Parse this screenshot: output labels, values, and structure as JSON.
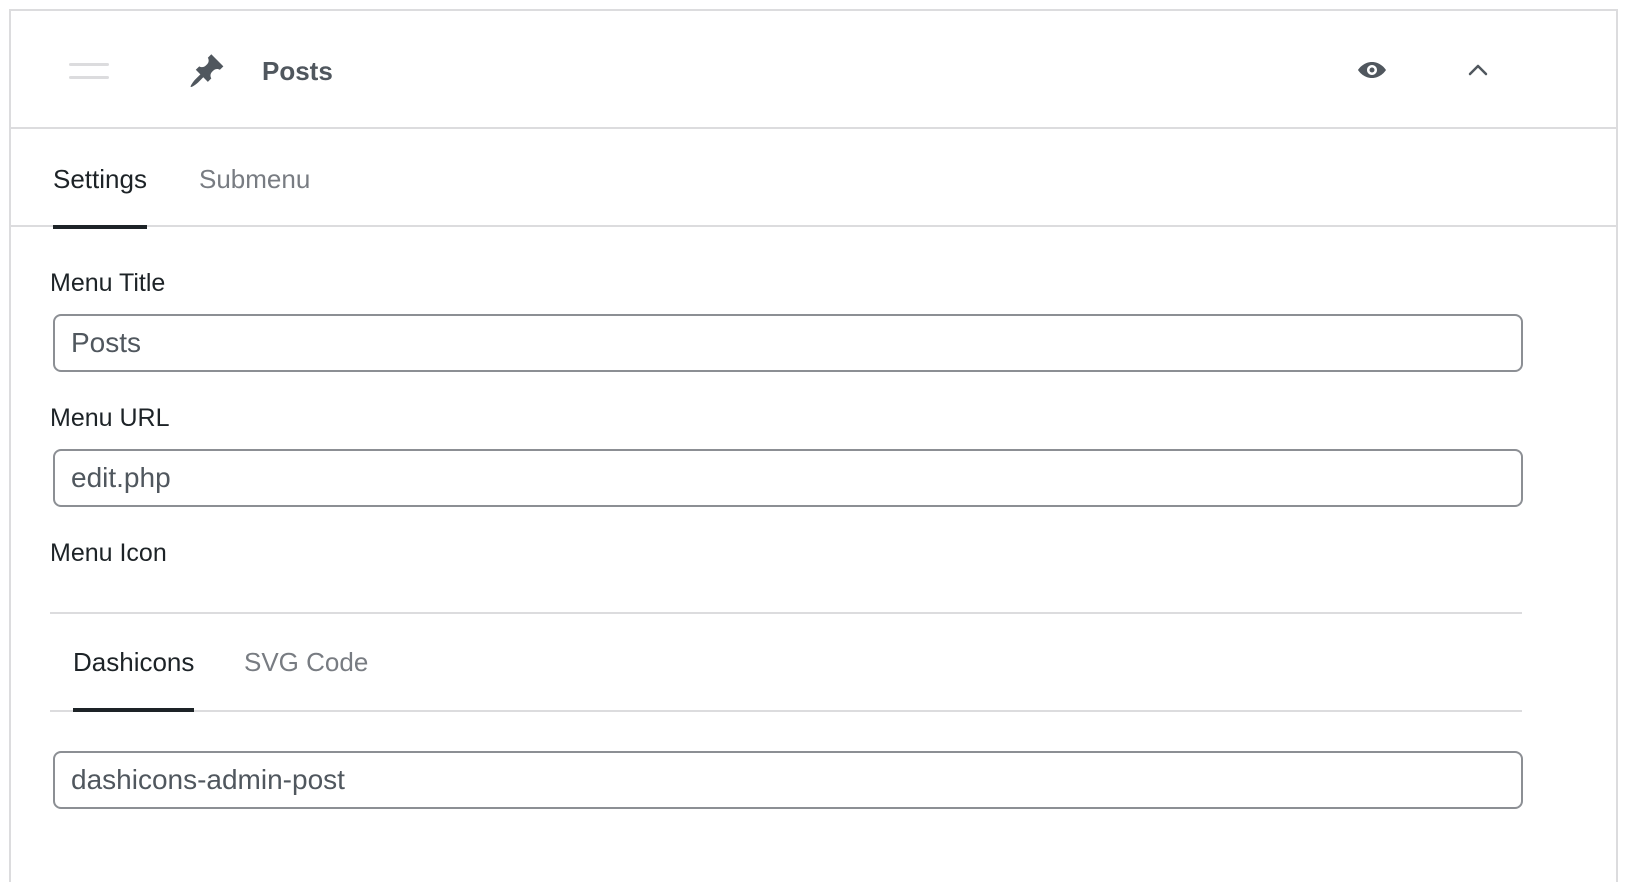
{
  "header": {
    "title": "Posts",
    "icons": {
      "drag": "drag-handle-icon",
      "menu": "pushpin-icon",
      "visibility": "eye-icon",
      "collapse": "chevron-up-icon"
    }
  },
  "tabs": [
    {
      "label": "Settings",
      "active": true
    },
    {
      "label": "Submenu",
      "active": false
    }
  ],
  "fields": {
    "menu_title": {
      "label": "Menu Title",
      "value": "Posts"
    },
    "menu_url": {
      "label": "Menu URL",
      "value": "edit.php"
    },
    "menu_icon": {
      "label": "Menu Icon",
      "value": "dashicons-admin-post"
    }
  },
  "icon_tabs": [
    {
      "label": "Dashicons",
      "active": true
    },
    {
      "label": "SVG Code",
      "active": false
    }
  ],
  "colors": {
    "border": "#dcdcde",
    "input_border": "#8c8f94",
    "active_text": "#1d2327",
    "inactive_text": "#787c82",
    "icon": "#50575e"
  }
}
